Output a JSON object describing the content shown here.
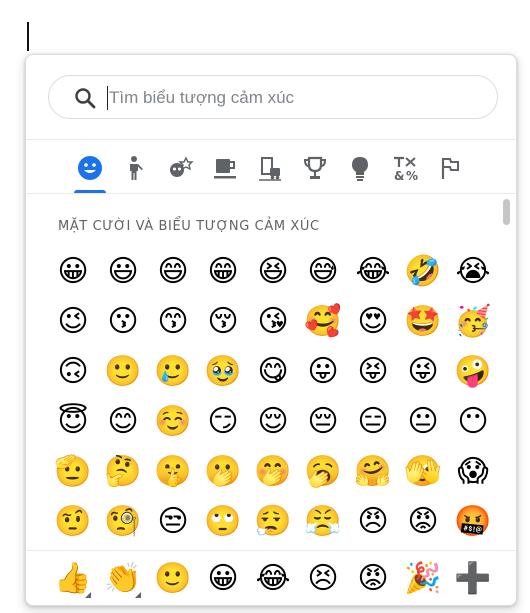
{
  "search": {
    "placeholder": "Tìm biểu tượng cảm xúc",
    "value": ""
  },
  "accent_color": "#1a73e8",
  "categories": [
    {
      "name": "Mặt cười và biểu tượng cảm xúc",
      "icon": "smiley-icon",
      "active": true
    },
    {
      "name": "Con người",
      "icon": "person-icon",
      "active": false
    },
    {
      "name": "Động vật và thiên nhiên",
      "icon": "animal-nature-icon",
      "active": false
    },
    {
      "name": "Đồ ăn và thức uống",
      "icon": "food-drink-icon",
      "active": false
    },
    {
      "name": "Du lịch và địa điểm",
      "icon": "travel-places-icon",
      "active": false
    },
    {
      "name": "Hoạt động",
      "icon": "trophy-icon",
      "active": false
    },
    {
      "name": "Đồ vật",
      "icon": "lightbulb-icon",
      "active": false
    },
    {
      "name": "Biểu tượng",
      "icon": "symbols-icon",
      "active": false
    },
    {
      "name": "Cờ",
      "icon": "flag-icon",
      "active": false
    }
  ],
  "section_title": "MẶT CƯỜI VÀ BIỂU TƯỢNG CẢM XÚC",
  "emoji_rows": [
    [
      "😀",
      "😃",
      "😄",
      "😁",
      "😆",
      "😅",
      "😂",
      "🤣",
      "😭"
    ],
    [
      "😉",
      "😗",
      "😙",
      "😚",
      "😘",
      "🥰",
      "😍",
      "🤩",
      "🥳"
    ],
    [
      "🙃",
      "🙂",
      "🥲",
      "🥹",
      "😋",
      "😛",
      "😝",
      "😜",
      "🤪"
    ],
    [
      "😇",
      "😊",
      "☺️",
      "😏",
      "😌",
      "😔",
      "😑",
      "😐",
      "😶"
    ],
    [
      "🫡",
      "🤔",
      "🤫",
      "🫢",
      "🤭",
      "🥱",
      "🤗",
      "🫣",
      "😱"
    ],
    [
      "🤨",
      "🧐",
      "😒",
      "🙄",
      "😮‍💨",
      "😤",
      "😠",
      "😡",
      "🤬"
    ]
  ],
  "recent": [
    {
      "emoji": "👍",
      "variants": true
    },
    {
      "emoji": "👏",
      "variants": true
    },
    {
      "emoji": "🙂",
      "variants": false
    },
    {
      "emoji": "😀",
      "variants": false
    },
    {
      "emoji": "😂",
      "variants": false
    },
    {
      "emoji": "😣",
      "variants": false
    },
    {
      "emoji": "😡",
      "variants": false
    },
    {
      "emoji": "🎉",
      "variants": false
    },
    {
      "emoji": "➕",
      "variants": false
    }
  ]
}
